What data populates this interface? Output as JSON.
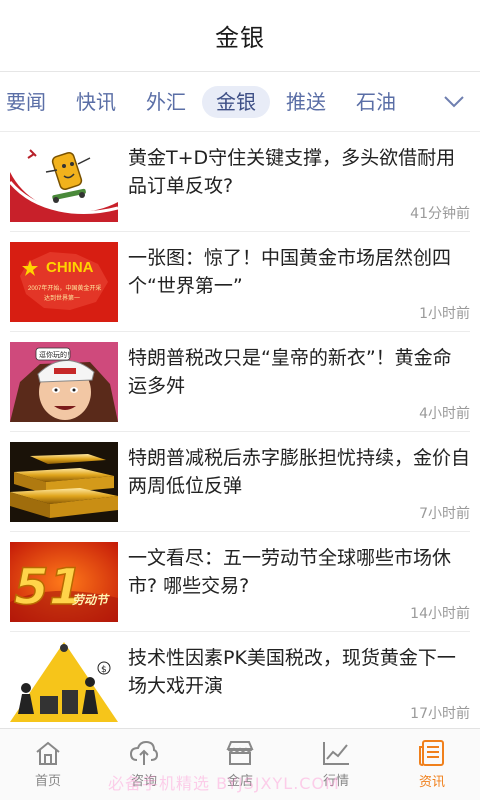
{
  "header": {
    "title": "金银"
  },
  "tabs": [
    {
      "label": "要闻"
    },
    {
      "label": "快讯"
    },
    {
      "label": "外汇"
    },
    {
      "label": "金银",
      "active": true
    },
    {
      "label": "推送"
    },
    {
      "label": "石油"
    }
  ],
  "news": [
    {
      "title": "黄金T+D守住关键支撑，多头欲借耐用品订单反攻?",
      "time": "41分钟前",
      "thumb": "gold-skateboard-cartoon"
    },
    {
      "title": "一张图：惊了！中国黄金市场居然创四个“世界第一”",
      "time": "1小时前",
      "thumb": "china-map",
      "thumb_text": {
        "headline": "CHINA",
        "line1": "2007年开始，中国黄金开采",
        "line2": "达到世界第一"
      }
    },
    {
      "title": "特朗普税改只是“皇帝的新衣”！黄金命运多舛",
      "time": "4小时前",
      "thumb": "caricature",
      "thumb_text": {
        "caption": "逗你玩的！"
      }
    },
    {
      "title": "特朗普减税后赤字膨胀担忧持续，金价自两周低位反弹",
      "time": "7小时前",
      "thumb": "gold-bars"
    },
    {
      "title": "一文看尽：五一劳动节全球哪些市场休市? 哪些交易?",
      "time": "14小时前",
      "thumb": "labor-day-51",
      "thumb_text": {
        "number": "51",
        "label": "劳动节"
      }
    },
    {
      "title": "技术性因素PK美国税改，现货黄金下一场大戏开演",
      "time": "17小时前",
      "thumb": "spotlight-money",
      "thumb_text": {
        "symbol": "$"
      }
    }
  ],
  "bottom_nav": [
    {
      "label": "首页",
      "icon": "home-icon"
    },
    {
      "label": "咨询",
      "icon": "cloud-upload-icon"
    },
    {
      "label": "金店",
      "icon": "store-icon"
    },
    {
      "label": "行情",
      "icon": "chart-icon"
    },
    {
      "label": "资讯",
      "icon": "news-icon",
      "active": true
    }
  ],
  "watermark": "必备手机精选 BYJSJXYL.COM",
  "colors": {
    "accent": "#f0801c",
    "tab_text": "#5a6ea6",
    "tab_active_bg": "#e8ecf7"
  }
}
